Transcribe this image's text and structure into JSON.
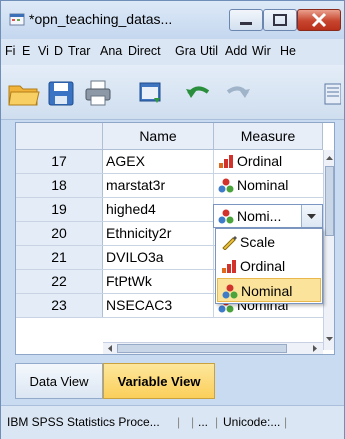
{
  "window": {
    "title": "*opn_teaching_datas...",
    "buttons": [
      "minimize-icon",
      "maximize-icon",
      "close-icon"
    ]
  },
  "menu": {
    "items": [
      "Fi",
      "E",
      "Vi",
      "D",
      "Trar",
      "Ana",
      "Direct",
      "Gra",
      "Util",
      "Add",
      "Wir",
      "He"
    ]
  },
  "toolbar": {
    "icons": [
      "open-folder-icon",
      "save-icon",
      "print-icon",
      "dialog-recall-icon",
      "undo-icon",
      "redo-icon",
      "goto-case-icon"
    ]
  },
  "grid": {
    "columns": [
      "Name",
      "Measure"
    ],
    "rows": [
      {
        "num": "17",
        "name": "AGEX",
        "measure": "Ordinal",
        "measure_icon": "ordinal-icon"
      },
      {
        "num": "18",
        "name": "marstat3r",
        "measure": "Nominal",
        "measure_icon": "nominal-icon"
      },
      {
        "num": "19",
        "name": "highed4",
        "measure": "Nomi...",
        "measure_icon": "nominal-icon"
      },
      {
        "num": "20",
        "name": "Ethnicity2r",
        "measure": "",
        "measure_icon": ""
      },
      {
        "num": "21",
        "name": "DVILO3a",
        "measure": "",
        "measure_icon": ""
      },
      {
        "num": "22",
        "name": "FtPtWk",
        "measure": "",
        "measure_icon": ""
      },
      {
        "num": "23",
        "name": "NSECAC3",
        "measure": "Nominal",
        "measure_icon": "nominal-icon"
      }
    ]
  },
  "dropdown": {
    "options": [
      "Scale",
      "Ordinal",
      "Nominal"
    ],
    "option_icons": [
      "scale-icon",
      "ordinal-icon",
      "nominal-icon"
    ],
    "selected": "Nominal"
  },
  "tabs": {
    "data_view": "Data View",
    "variable_view": "Variable View",
    "active": "Variable View"
  },
  "status": {
    "processor": "IBM SPSS Statistics Proce...",
    "seg2": "",
    "seg3": "...",
    "encoding": "Unicode:..."
  },
  "colors": {
    "selected_highlight": "#fbe39b",
    "active_tab": "#fbd46a",
    "close_button": "#c7452e"
  }
}
